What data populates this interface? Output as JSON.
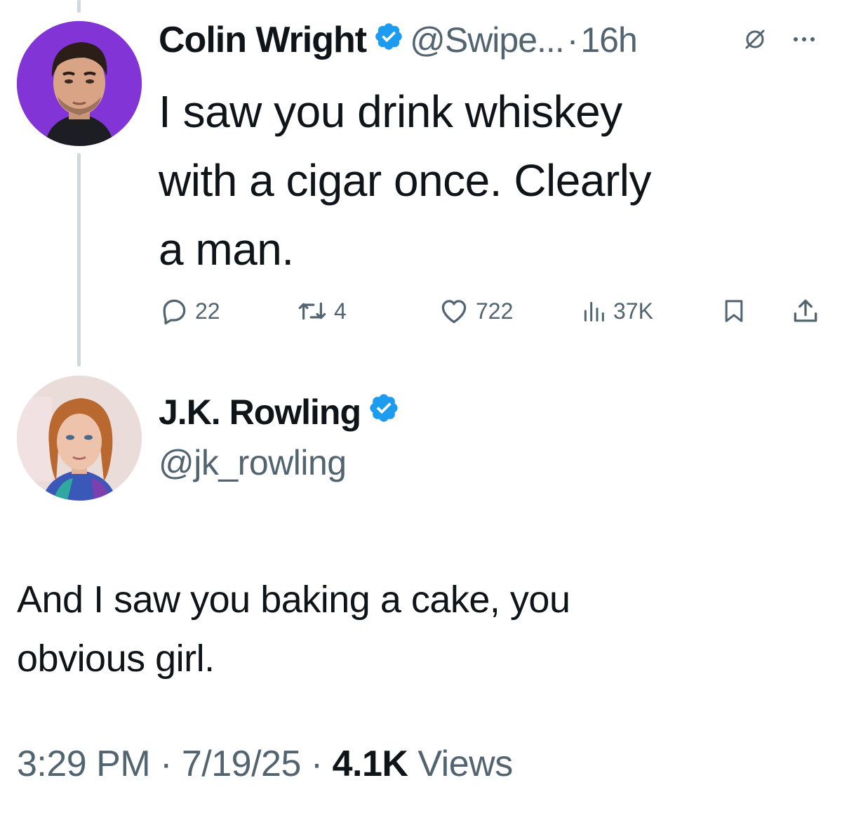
{
  "reply_tweet": {
    "author_name": "Colin Wright",
    "handle": "@Swipe...",
    "separator": "·",
    "time": "16h",
    "text_lines": [
      "I saw you drink whiskey",
      "with a cigar once. Clearly",
      "a man."
    ],
    "actions": {
      "replies": "22",
      "reposts": "4",
      "likes": "722",
      "views": "37K"
    },
    "icons": {
      "grok": "grok-icon",
      "more": "more-icon",
      "reply": "reply-icon",
      "repost": "repost-icon",
      "like": "heart-icon",
      "views": "views-icon",
      "bookmark": "bookmark-icon",
      "share": "share-icon"
    }
  },
  "main_tweet": {
    "author_name": "J.K. Rowling",
    "handle": "@jk_rowling",
    "text_lines": [
      "And I saw you baking a cake, you",
      "obvious girl."
    ],
    "time": "3:29 PM",
    "date": "7/19/25",
    "views_count": "4.1K",
    "views_label": "Views",
    "separator": "·"
  },
  "colors": {
    "text": "#0f1419",
    "secondary": "#536471",
    "verified": "#1d9bf0",
    "thread_line": "#cfd9de"
  }
}
